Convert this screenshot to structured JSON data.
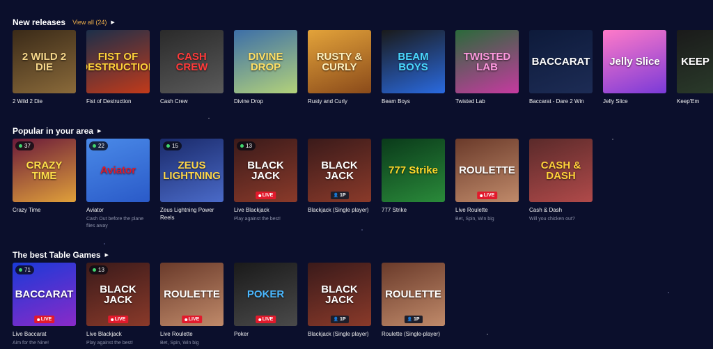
{
  "sections": {
    "new_releases": {
      "title": "New releases",
      "view_all": "View all (24)",
      "games": [
        {
          "name": "2 Wild 2 Die",
          "logo": "2 WILD 2 DIE",
          "colors": [
            "#3a2a18",
            "#8a6a3a"
          ],
          "logo_color": "#f5d68a"
        },
        {
          "name": "Fist of Destruction",
          "logo": "FIST OF DESTRUCTION",
          "colors": [
            "#1c2f4a",
            "#c23a1a"
          ],
          "logo_color": "#ffd23a"
        },
        {
          "name": "Cash Crew",
          "logo": "CASH CREW",
          "colors": [
            "#2a2a2a",
            "#5a5a5a"
          ],
          "logo_color": "#ff3a3a"
        },
        {
          "name": "Divine Drop",
          "logo": "DIVINE DROP",
          "colors": [
            "#3c6ea8",
            "#b3d27a"
          ],
          "logo_color": "#ffe066"
        },
        {
          "name": "Rusty and Curly",
          "logo": "RUSTY & CURLY",
          "colors": [
            "#e3a33a",
            "#8a4a1a"
          ],
          "logo_color": "#fff2c0"
        },
        {
          "name": "Beam Boys",
          "logo": "BEAM BOYS",
          "colors": [
            "#1a1a1a",
            "#2a6ae0"
          ],
          "logo_color": "#4ad8ff"
        },
        {
          "name": "Twisted Lab",
          "logo": "TWISTED LAB",
          "colors": [
            "#2a6a3a",
            "#c63aa0"
          ],
          "logo_color": "#ff9ae0"
        },
        {
          "name": "Baccarat - Dare 2 Win",
          "logo": "BACCARAT",
          "colors": [
            "#0d1a3a",
            "#1d2c55"
          ],
          "logo_color": "#ffffff"
        },
        {
          "name": "Jelly Slice",
          "logo": "Jelly Slice",
          "colors": [
            "#ff7ac8",
            "#7a3ad8"
          ],
          "logo_color": "#ffffff"
        },
        {
          "name": "Keep'Em",
          "logo": "KEEP",
          "colors": [
            "#1a1a1a",
            "#2a3a2a"
          ],
          "logo_color": "#ffffff"
        }
      ]
    },
    "popular": {
      "title": "Popular in your area",
      "games": [
        {
          "name": "Crazy Time",
          "desc": "",
          "count": "37",
          "logo": "CRAZY TIME",
          "colors": [
            "#6a1a3a",
            "#e0a03a"
          ],
          "logo_color": "#ffe04a",
          "badge": ""
        },
        {
          "name": "Aviator",
          "desc": "Cash Out before the plane flies away",
          "count": "22",
          "logo": "Aviator",
          "colors": [
            "#4a8ae8",
            "#2a5ac8"
          ],
          "logo_color": "#e01a2a",
          "badge": ""
        },
        {
          "name": "Zeus Lightning Power Reels",
          "desc": "",
          "count": "15",
          "logo": "ZEUS LIGHTNING",
          "colors": [
            "#1a2a6a",
            "#4a6ac8"
          ],
          "logo_color": "#ffd84a",
          "badge": ""
        },
        {
          "name": "Live Blackjack",
          "desc": "Play against the best!",
          "count": "13",
          "logo": "BLACK JACK",
          "colors": [
            "#3a1a1a",
            "#8a3a2a"
          ],
          "logo_color": "#ffffff",
          "badge": "LIVE"
        },
        {
          "name": "Blackjack (Single player)",
          "desc": "",
          "count": "",
          "logo": "BLACK JACK",
          "colors": [
            "#3a1a1a",
            "#8a3a2a"
          ],
          "logo_color": "#ffffff",
          "badge": "1P"
        },
        {
          "name": "777 Strike",
          "desc": "",
          "count": "",
          "logo": "777 Strike",
          "colors": [
            "#0a3a1a",
            "#2a8a3a"
          ],
          "logo_color": "#ffd82a",
          "badge": ""
        },
        {
          "name": "Live Roulette",
          "desc": "Bet, Spin, Win big",
          "count": "",
          "logo": "ROULETTE",
          "colors": [
            "#6a3a2a",
            "#c08a6a"
          ],
          "logo_color": "#ffffff",
          "badge": "LIVE"
        },
        {
          "name": "Cash & Dash",
          "desc": "Will you chicken out?",
          "count": "",
          "logo": "CASH & DASH",
          "colors": [
            "#5a2a2a",
            "#b04a4a"
          ],
          "logo_color": "#ffd23a",
          "badge": ""
        }
      ]
    },
    "table_games": {
      "title": "The best Table Games",
      "games": [
        {
          "name": "Live Baccarat",
          "desc": "Aim for the Nine!",
          "count": "71",
          "logo": "BACCARAT",
          "colors": [
            "#1a3ad8",
            "#8a2ac8"
          ],
          "logo_color": "#ffffff",
          "badge": "LIVE"
        },
        {
          "name": "Live Blackjack",
          "desc": "Play against the best!",
          "count": "13",
          "logo": "BLACK JACK",
          "colors": [
            "#3a1a1a",
            "#8a3a2a"
          ],
          "logo_color": "#ffffff",
          "badge": "LIVE"
        },
        {
          "name": "Live Roulette",
          "desc": "Bet, Spin, Win big",
          "count": "",
          "logo": "ROULETTE",
          "colors": [
            "#6a3a2a",
            "#c08a6a"
          ],
          "logo_color": "#ffffff",
          "badge": "LIVE"
        },
        {
          "name": "Poker",
          "desc": "",
          "count": "",
          "logo": "POKER",
          "colors": [
            "#1a1a1a",
            "#4a4a4a"
          ],
          "logo_color": "#4ab8ff",
          "badge": "LIVE"
        },
        {
          "name": "Blackjack (Single player)",
          "desc": "",
          "count": "",
          "logo": "BLACK JACK",
          "colors": [
            "#3a1a1a",
            "#8a3a2a"
          ],
          "logo_color": "#ffffff",
          "badge": "1P"
        },
        {
          "name": "Roulette (Single-player)",
          "desc": "",
          "count": "",
          "logo": "ROULETTE",
          "colors": [
            "#6a3a2a",
            "#c08a6a"
          ],
          "logo_color": "#ffffff",
          "badge": "1P"
        }
      ]
    }
  },
  "badges": {
    "live": "LIVE",
    "single": "1P"
  },
  "accent": "#f0b04a"
}
